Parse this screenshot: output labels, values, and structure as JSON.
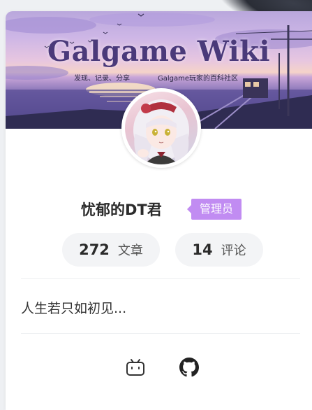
{
  "banner": {
    "title": "Galgame Wiki",
    "subtitle_left": "发现、记录、分享",
    "subtitle_right": "Galgame玩家的百科社区"
  },
  "profile": {
    "username": "忧郁的DT君",
    "role": "管理员",
    "bio": "人生若只如初见..."
  },
  "stats": [
    {
      "value": "272",
      "label": "文章"
    },
    {
      "value": "14",
      "label": "评论"
    }
  ],
  "social": [
    {
      "icon": "bilibili-icon"
    },
    {
      "icon": "github-icon"
    }
  ],
  "colors": {
    "badge": "#c18cf2",
    "banner_title": "#4a3a7a"
  }
}
